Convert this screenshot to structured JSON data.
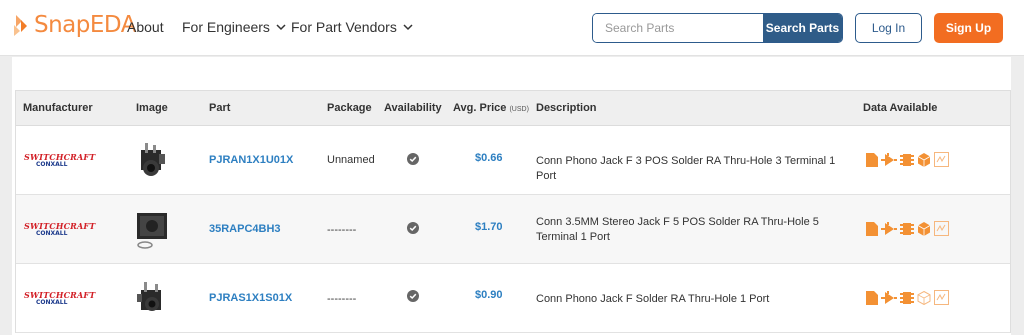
{
  "header": {
    "logo_text": "SnapEDA",
    "nav": [
      "About",
      "For Engineers",
      "For Part Vendors"
    ],
    "search_placeholder": "Search Parts",
    "search_button": "Search Parts",
    "login": "Log In",
    "signup": "Sign Up"
  },
  "table": {
    "columns": {
      "manufacturer": "Manufacturer",
      "image": "Image",
      "part": "Part",
      "package": "Package",
      "availability": "Availability",
      "price": "Avg. Price",
      "price_unit": "(USD)",
      "description": "Description",
      "data": "Data Available"
    },
    "rows": [
      {
        "manufacturer_logo_line1": "SWITCHCRAFT",
        "manufacturer_logo_line2": "CONXALL",
        "part": "PJRAN1X1U01X",
        "package": "Unnamed",
        "price": "$0.66",
        "description": "Conn Phono Jack F 3 POS Solder RA Thru-Hole 3 Terminal 1 Port",
        "available": true,
        "data_icons": [
          "datasheet-icon",
          "symbol-icon",
          "footprint-icon",
          "3d-model-icon",
          "sim-model-outline-icon"
        ]
      },
      {
        "manufacturer_logo_line1": "SWITCHCRAFT",
        "manufacturer_logo_line2": "CONXALL",
        "part": "35RAPC4BH3",
        "package": "--------",
        "price": "$1.70",
        "description": "Conn 3.5MM Stereo Jack F 5 POS Solder RA Thru-Hole 5 Terminal 1 Port",
        "available": true,
        "data_icons": [
          "datasheet-icon",
          "symbol-icon",
          "footprint-icon",
          "3d-model-icon",
          "sim-model-outline-icon"
        ]
      },
      {
        "manufacturer_logo_line1": "SWITCHCRAFT",
        "manufacturer_logo_line2": "CONXALL",
        "part": "PJRAS1X1S01X",
        "package": "--------",
        "price": "$0.90",
        "description": "Conn Phono Jack F Solder RA Thru-Hole 1 Port",
        "available": true,
        "data_icons": [
          "datasheet-icon",
          "symbol-icon",
          "footprint-icon",
          "3d-model-outline-icon",
          "sim-model-outline-icon"
        ]
      }
    ]
  },
  "colors": {
    "brand_orange": "#f26d21",
    "nav_blue": "#2f5c88",
    "link_blue": "#2d7fc1",
    "icon_orange": "#f39134"
  }
}
